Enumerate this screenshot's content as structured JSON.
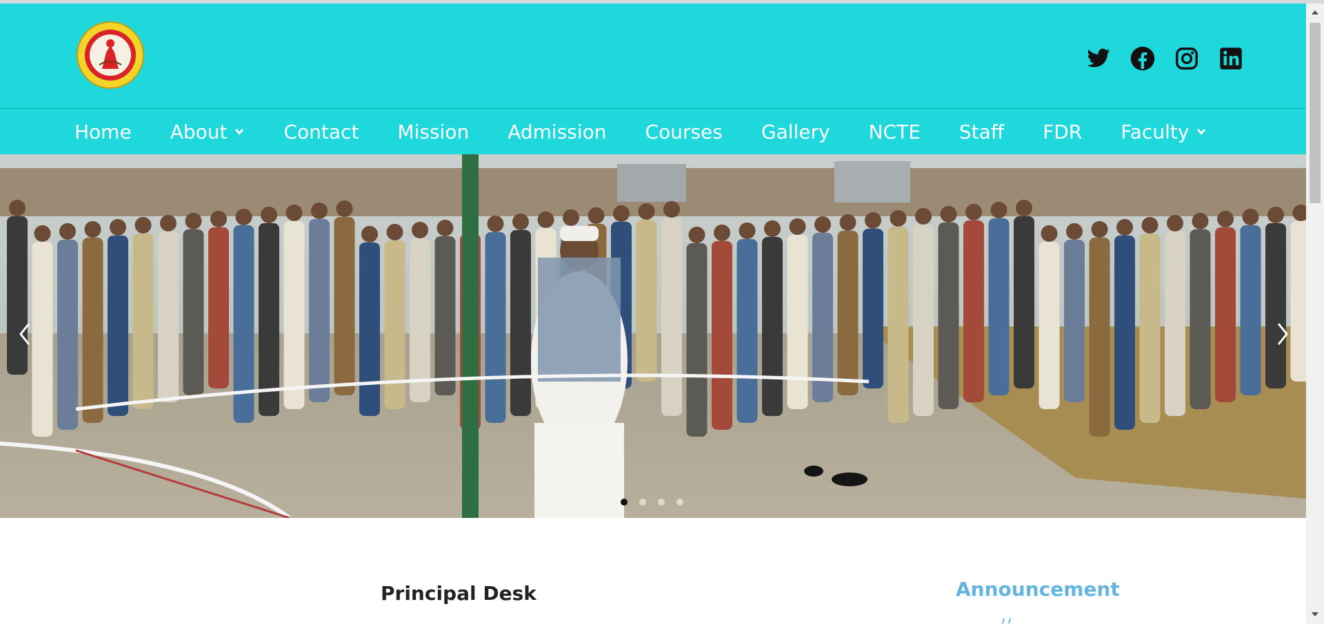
{
  "header": {
    "logo_alt": "KAPILDEO RAY S.S. (+2) VIDYALAYA",
    "socials": [
      {
        "icon": "twitter-icon",
        "label": "Twitter"
      },
      {
        "icon": "facebook-icon",
        "label": "Facebook"
      },
      {
        "icon": "instagram-icon",
        "label": "Instagram"
      },
      {
        "icon": "linkedin-icon",
        "label": "LinkedIn"
      }
    ]
  },
  "nav": {
    "items": [
      {
        "label": "Home",
        "dropdown": false
      },
      {
        "label": "About",
        "dropdown": true
      },
      {
        "label": "Contact",
        "dropdown": false
      },
      {
        "label": "Mission",
        "dropdown": false
      },
      {
        "label": "Admission",
        "dropdown": false
      },
      {
        "label": "Courses",
        "dropdown": false
      },
      {
        "label": "Gallery",
        "dropdown": false
      },
      {
        "label": "NCTE",
        "dropdown": false
      },
      {
        "label": "Staff",
        "dropdown": false
      },
      {
        "label": "FDR",
        "dropdown": false
      },
      {
        "label": "Faculty",
        "dropdown": true
      }
    ]
  },
  "carousel": {
    "slide_count": 4,
    "active_index": 0,
    "prev_icon": "chevron-left-icon",
    "next_icon": "chevron-right-icon"
  },
  "main": {
    "principal_title": "Principal Desk",
    "announcement_title": "Announcement"
  },
  "colors": {
    "header_bg": "#1ed8dc",
    "nav_text": "#ffffff",
    "announcement": "#63b4e0",
    "principal_text": "#222222"
  }
}
